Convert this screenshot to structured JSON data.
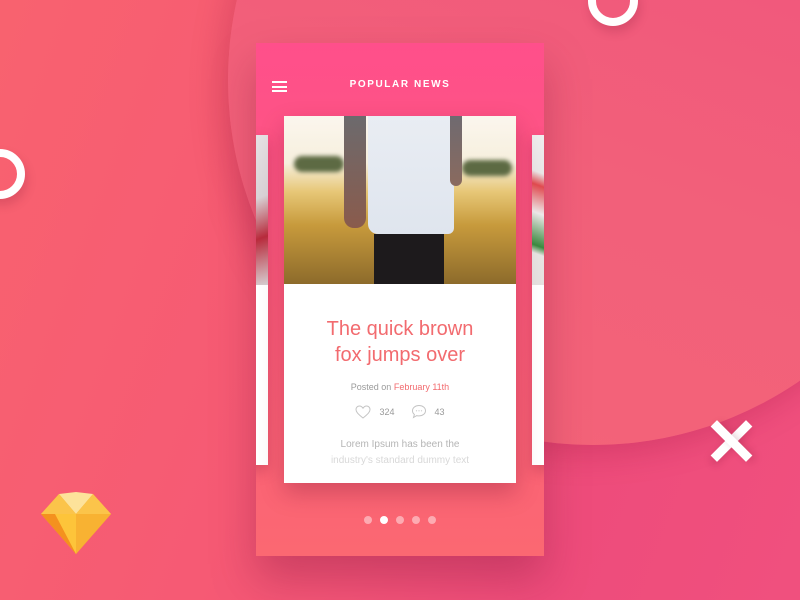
{
  "header": {
    "title": "POPULAR NEWS",
    "menu_icon": "hamburger-menu-icon"
  },
  "article": {
    "image_alt": "Tattooed person in white shirt walking through golden wheat field",
    "headline_line1": "The quick brown",
    "headline_line2": "fox jumps over",
    "posted_prefix": "Posted on",
    "posted_date": "February 11th",
    "likes": "324",
    "comments": "43",
    "excerpt_line1": "Lorem Ipsum has been the",
    "excerpt_line2": "industry's standard dummy text"
  },
  "pagination": {
    "total": 5,
    "active_index": 1
  },
  "decor": {
    "sketch_logo": "sketch-diamond-icon",
    "accent_color": "#f26b6f",
    "header_color": "#ff4f8b"
  }
}
